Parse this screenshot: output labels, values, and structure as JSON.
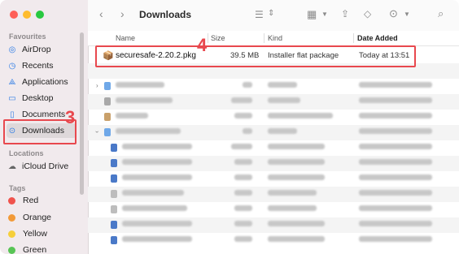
{
  "window": {
    "title": "Downloads"
  },
  "sidebar": {
    "favourites_heading": "Favourites",
    "favourites": [
      {
        "label": "AirDrop",
        "icon": "airdrop-icon"
      },
      {
        "label": "Recents",
        "icon": "clock-icon"
      },
      {
        "label": "Applications",
        "icon": "applications-icon"
      },
      {
        "label": "Desktop",
        "icon": "desktop-icon"
      },
      {
        "label": "Documents",
        "icon": "document-icon"
      },
      {
        "label": "Downloads",
        "icon": "download-icon",
        "selected": true
      }
    ],
    "locations_heading": "Locations",
    "locations": [
      {
        "label": "iCloud Drive",
        "icon": "cloud-icon"
      }
    ],
    "tags_heading": "Tags",
    "tags": [
      {
        "label": "Red",
        "color": "#f0534d"
      },
      {
        "label": "Orange",
        "color": "#f29a38"
      },
      {
        "label": "Yellow",
        "color": "#f6cf3a"
      },
      {
        "label": "Green",
        "color": "#58c455"
      }
    ]
  },
  "columns": {
    "name": "Name",
    "size": "Size",
    "kind": "Kind",
    "date_added": "Date Added"
  },
  "highlighted_file": {
    "name": "securesafe-2.20.2.pkg",
    "size": "39.5 MB",
    "kind": "Installer flat package",
    "date_added": "Today at 13:51"
  },
  "annotations": {
    "step_downloads": "3",
    "step_file": "4"
  },
  "colors": {
    "annotation": "#e8484e",
    "accent": "#2c7be5"
  }
}
